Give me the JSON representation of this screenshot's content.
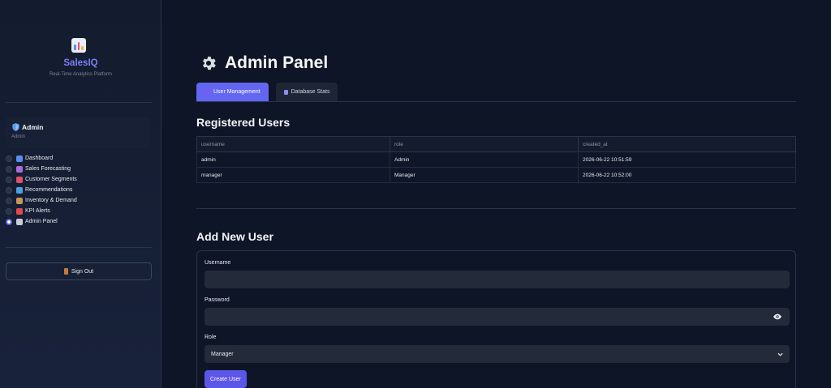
{
  "sidebar": {
    "brand": "SalesIQ",
    "tagline": "Real-Time Analytics Platform",
    "user": {
      "name": "Admin",
      "role": "Admin"
    },
    "nav": [
      {
        "label": "Dashboard",
        "icon": "bar-chart-icon",
        "color": "#5b8def",
        "active": false
      },
      {
        "label": "Sales Forecasting",
        "icon": "crystal-ball-icon",
        "color": "#b06ad9",
        "active": false
      },
      {
        "label": "Customer Segments",
        "icon": "target-icon",
        "color": "#e0506a",
        "active": false
      },
      {
        "label": "Recommendations",
        "icon": "shopping-bags-icon",
        "color": "#4aa3e0",
        "active": false
      },
      {
        "label": "Inventory & Demand",
        "icon": "package-icon",
        "color": "#c9965a",
        "active": false
      },
      {
        "label": "KPI Alerts",
        "icon": "siren-icon",
        "color": "#e04a4a",
        "active": false
      },
      {
        "label": "Admin Panel",
        "icon": "gear-icon",
        "color": "#c8ccd6",
        "active": true
      }
    ],
    "signout_label": "Sign Out"
  },
  "main": {
    "title": "Admin Panel",
    "tabs": [
      {
        "label": "User Management",
        "active": true
      },
      {
        "label": "Database Stats",
        "active": false
      }
    ],
    "users_heading": "Registered Users",
    "table": {
      "columns": [
        "username",
        "role",
        "created_at"
      ],
      "rows": [
        [
          "admin",
          "Admin",
          "2026-06-22 10:51:59"
        ],
        [
          "manager",
          "Manager",
          "2026-06-22 10:52:00"
        ]
      ]
    },
    "add_heading": "Add New User",
    "form": {
      "username_label": "Username",
      "username_value": "",
      "password_label": "Password",
      "password_value": "",
      "role_label": "Role",
      "role_value": "Manager",
      "submit_label": "Create User"
    }
  },
  "colors": {
    "accent": "#6366f1",
    "brand": "#7b7ff5",
    "background": "#0e1526"
  }
}
